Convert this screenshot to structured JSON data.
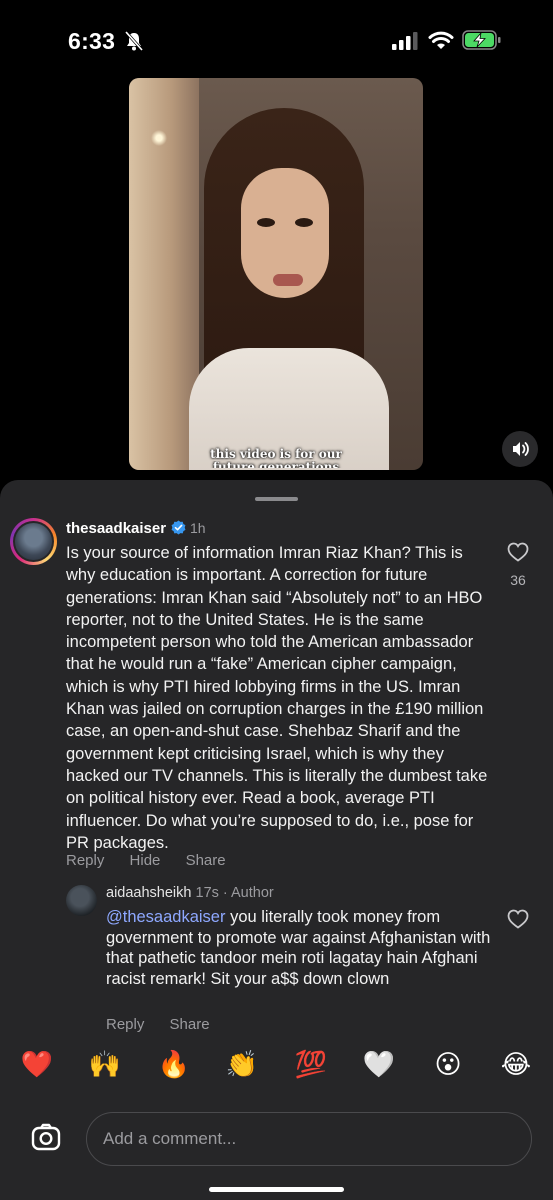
{
  "status_bar": {
    "time": "6:33"
  },
  "video": {
    "caption_line1": "this video is for our",
    "caption_line2": "future generations"
  },
  "comment": {
    "username": "thesaadkaiser",
    "time": "1h",
    "text": "Is your source of information Imran Riaz Khan? This is why education is important. A correction for future generations: Imran Khan said “Absolutely not” to an HBO reporter, not to the United States. He is the same incompetent person who told the American ambassador that he would run a “fake” American cipher campaign, which is why PTI hired lobbying firms in the US. Imran Khan was jailed on corruption charges in the £190 million case, an open-and-shut case. Shehbaz Sharif and the government kept criticising Israel, which is why they hacked our TV channels. This is literally the dumbest take on political history ever. Read a book, average PTI influencer. Do what you’re supposed to do, i.e., pose for PR packages.",
    "like_count": "36",
    "actions": {
      "reply": "Reply",
      "hide": "Hide",
      "share": "Share"
    }
  },
  "reply": {
    "username": "aidaahsheikh",
    "time": "17s",
    "separator": "·",
    "role": "Author",
    "mention": "@thesaadkaiser",
    "text": " you literally took money from government to promote war against Afghanistan with that pathetic tandoor mein roti lagatay hain Afghani racist remark! Sit your a$$ down clown",
    "actions": {
      "reply": "Reply",
      "share": "Share"
    }
  },
  "quick_reactions": [
    "❤️",
    "🙌",
    "🔥",
    "👏",
    "💯",
    "🤍",
    "😮",
    "😂"
  ],
  "composer": {
    "placeholder": "Add a comment..."
  },
  "icons": {
    "bell": "bell-slash-icon",
    "signal": "signal-icon",
    "wifi": "wifi-icon",
    "battery": "battery-charging-icon",
    "sound": "speaker-icon",
    "verified": "verified-badge-icon",
    "like": "heart-icon",
    "camera": "camera-icon"
  },
  "colors": {
    "sheet": "#262628",
    "mention": "#8ea8ff",
    "battery": "#4cd964",
    "verified": "#3797f0"
  }
}
